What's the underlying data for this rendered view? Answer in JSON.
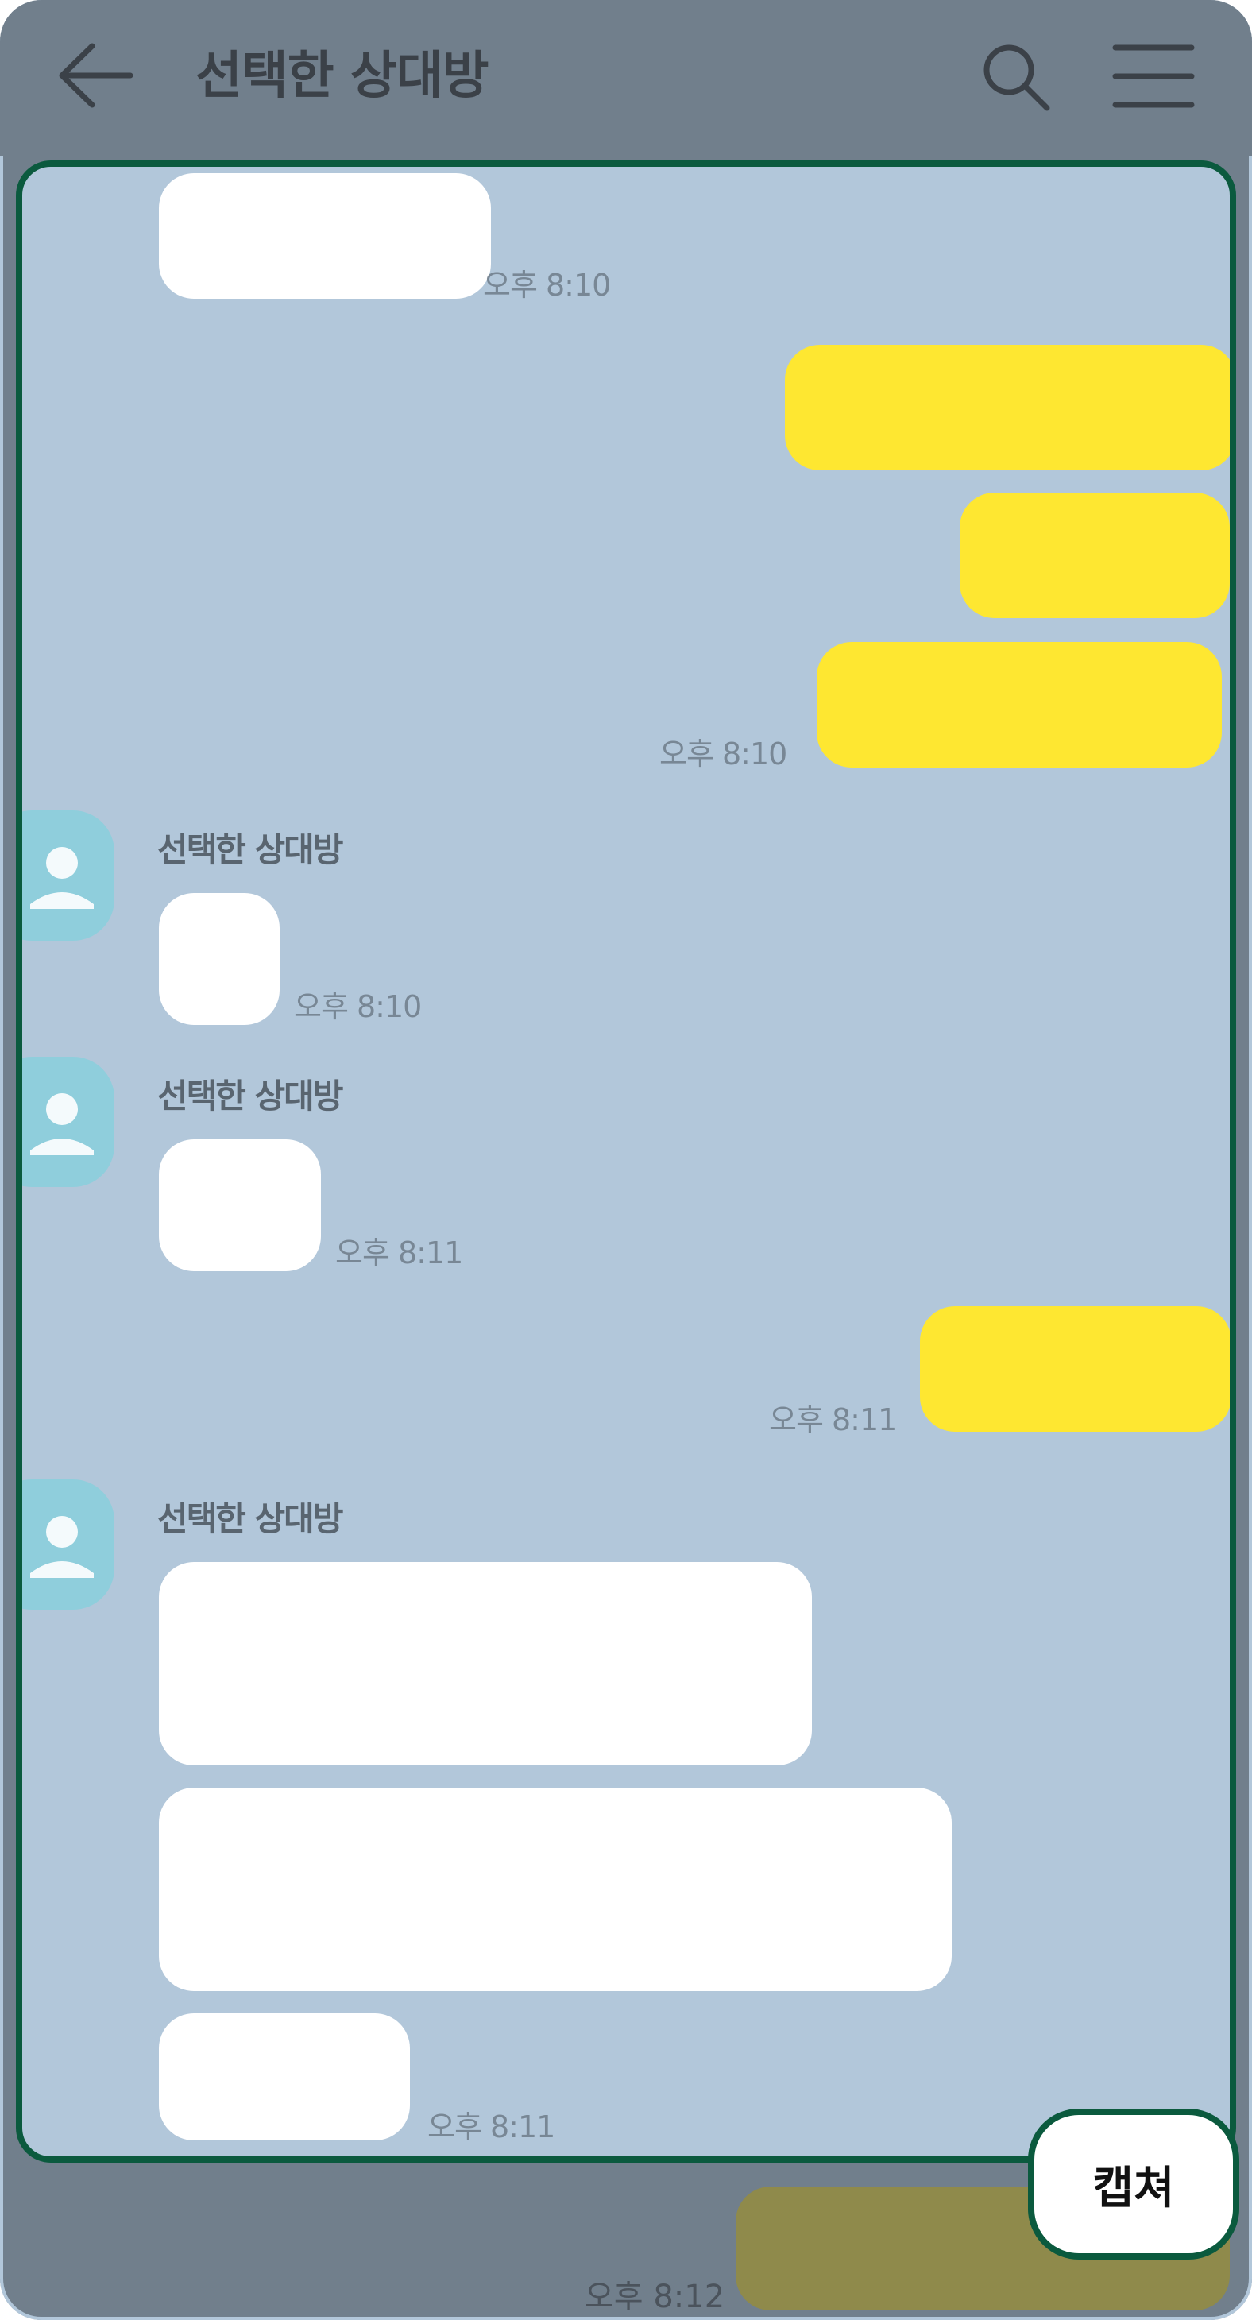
{
  "header": {
    "title": "선택한 상대방",
    "back_icon": "arrow-left-icon",
    "search_icon": "search-icon",
    "menu_icon": "hamburger-menu-icon"
  },
  "chat": {
    "sender_name": "선택한 상대방",
    "times": {
      "t1": "오후 8:10",
      "t2": "오후 8:10",
      "t3": "오후 8:10",
      "t4": "오후 8:11",
      "t5": "오후 8:11",
      "t6": "오후 8:11"
    },
    "colors": {
      "background": "#b2c7da",
      "incoming_bubble": "#ffffff",
      "outgoing_bubble": "#fee731",
      "avatar": "#8fcedc",
      "frame_border": "#0b5a3e"
    }
  },
  "bottom": {
    "time": "오후 8:12"
  },
  "capture_button": {
    "label": "캡쳐"
  }
}
